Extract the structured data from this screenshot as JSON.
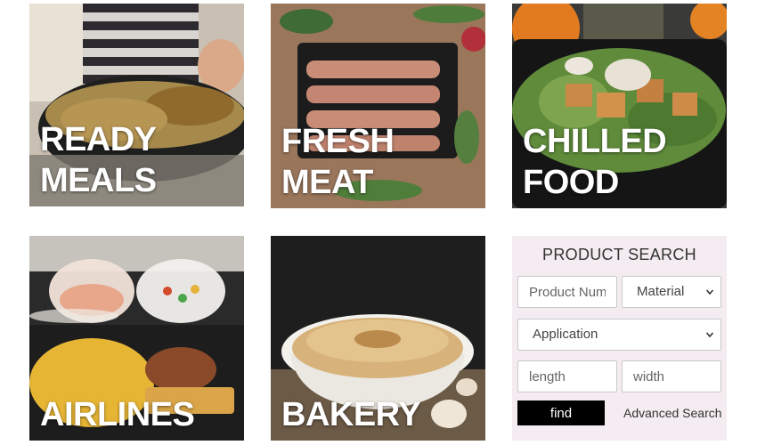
{
  "tiles": [
    {
      "id": "ready-meals",
      "line1": "READY",
      "line2": "MEALS"
    },
    {
      "id": "fresh-meat",
      "line1": "FRESH",
      "line2": "MEAT"
    },
    {
      "id": "chilled-food",
      "line1": "CHILLED",
      "line2": "FOOD"
    },
    {
      "id": "airlines",
      "line1": "AIRLINES",
      "line2": ""
    },
    {
      "id": "bakery",
      "line1": "BAKERY",
      "line2": ""
    }
  ],
  "search": {
    "title": "PRODUCT SEARCH",
    "product_number_placeholder": "Product Number",
    "material_label": "Material",
    "application_label": "Application",
    "length_placeholder": "length",
    "width_placeholder": "width",
    "find_label": "find",
    "advanced_label": "Advanced Search"
  },
  "colors": {
    "panel_bg": "#f4ecf0",
    "button_bg": "#000000",
    "tile_text": "#ffffff"
  }
}
